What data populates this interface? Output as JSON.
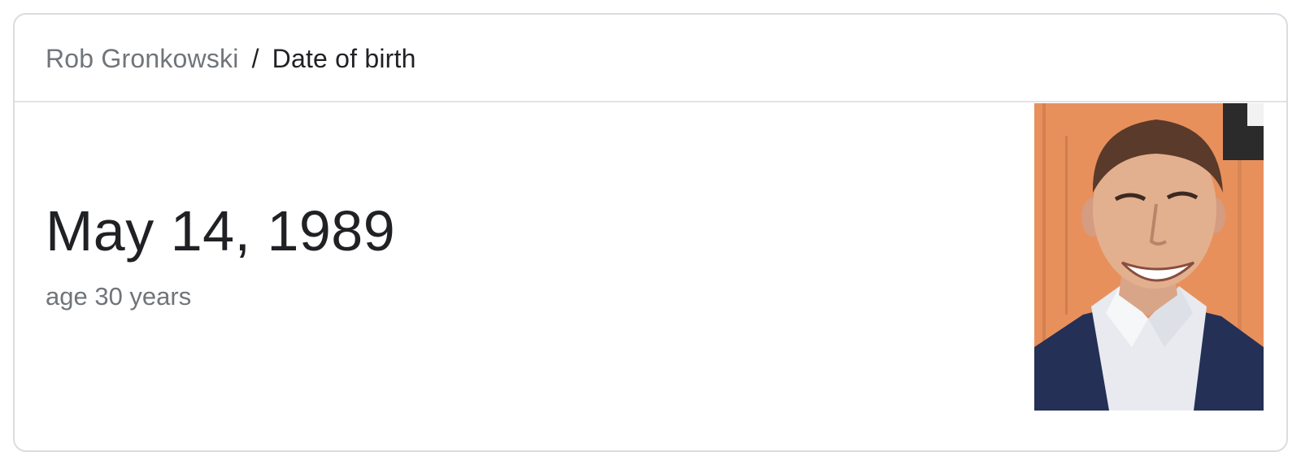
{
  "breadcrumb": {
    "entity": "Rob Gronkowski",
    "separator": "/",
    "attribute": "Date of birth"
  },
  "answer": {
    "value": "May 14, 1989",
    "subtext": "age 30 years"
  },
  "photo": {
    "icon": "person-portrait-icon"
  },
  "colors": {
    "card_border": "#dadce0",
    "primary_text": "#202124",
    "secondary_text": "#70757a",
    "photo_background": "#e9925f"
  }
}
